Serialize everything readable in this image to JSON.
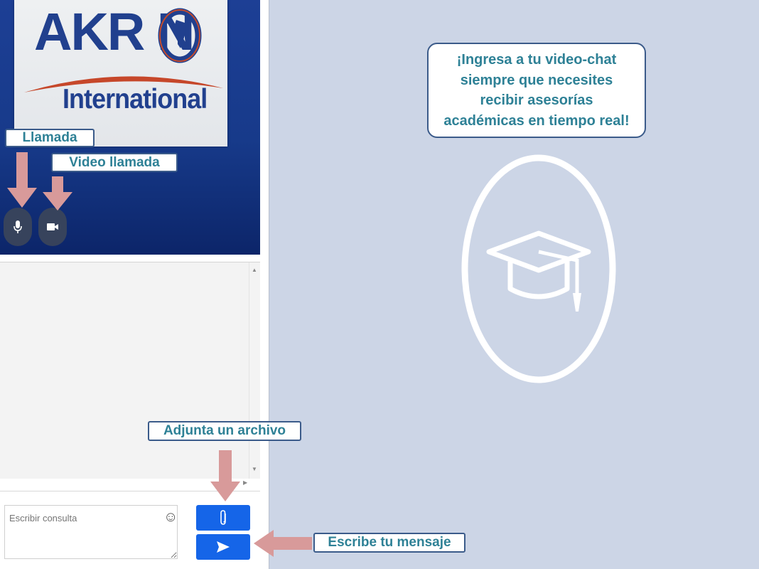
{
  "logo": {
    "main": "AKR N",
    "sub": "International"
  },
  "video_controls": {
    "mic_icon": "microphone-icon",
    "video_icon": "video-camera-icon"
  },
  "callouts": {
    "call": "Llamada",
    "video_call": "Video llamada",
    "attach": "Adjunta un archivo",
    "write": "Escribe tu mensaje"
  },
  "composer": {
    "placeholder": "Escribir consulta",
    "emoji_icon": "emoji-icon",
    "attach_icon": "paperclip-icon",
    "send_icon": "send-icon"
  },
  "info_box": {
    "lines": [
      "¡Ingresa a tu video-chat",
      "siempre que necesites",
      "recibir asesorías",
      "académicas en tiempo real!"
    ]
  },
  "emblem": {
    "icon": "graduation-cap-icon"
  },
  "colors": {
    "background": "#ccd5e6",
    "accent_text": "#2e8196",
    "border": "#3b5b8a",
    "button_blue": "#1565e8",
    "arrow": "#d89a9a",
    "logo_blue": "#21408e"
  }
}
